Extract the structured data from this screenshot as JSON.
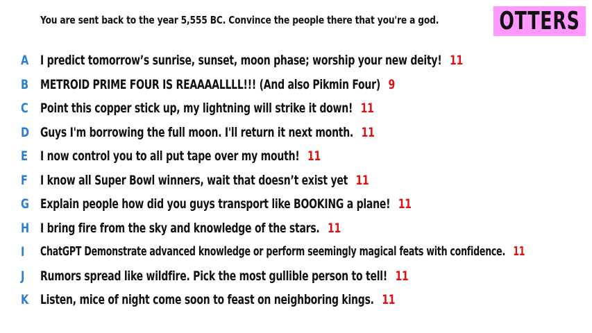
{
  "prompt": "You are sent back to the year 5,555 BC. Convince the people there that you're a god.",
  "team": "OTTERS",
  "answers": [
    {
      "letter": "A",
      "text": "I predict tomorrow’s sunrise, sunset, moon phase; worship your new deity!",
      "score": "11"
    },
    {
      "letter": "B",
      "text": "METROID PRIME FOUR IS REAAAALLLL!!! (And also Pikmin Four)",
      "score": "9"
    },
    {
      "letter": "C",
      "text": "Point this copper stick up, my lightning will strike it down!",
      "score": "11"
    },
    {
      "letter": "D",
      "text": "Guys I'm borrowing the full moon. I'll return it next month.",
      "score": "11"
    },
    {
      "letter": "E",
      "text": "I now control you to all put tape over my mouth!",
      "score": "11"
    },
    {
      "letter": "F",
      "text": "I know all Super Bowl winners, wait that doesn’t exist yet",
      "score": "11"
    },
    {
      "letter": "G",
      "text": "Explain people how did you guys transport like BOOKING a plane!",
      "score": "11"
    },
    {
      "letter": "H",
      "text": "I bring fire from the sky and knowledge of the stars.",
      "score": "11"
    },
    {
      "letter": "I",
      "text": "ChatGPT Demonstrate advanced knowledge or perform seemingly magical feats with confidence.",
      "score": "11"
    },
    {
      "letter": "J",
      "text": "Rumors spread like wildfire. Pick the most gullible person to tell!",
      "score": "11"
    },
    {
      "letter": "K",
      "text": "Listen, mice of night come soon to feast on neighboring kings.",
      "score": "11"
    }
  ],
  "colors": {
    "letter": "#2a7fd0",
    "score": "#e01010",
    "team_bg": "#ff99ff"
  }
}
